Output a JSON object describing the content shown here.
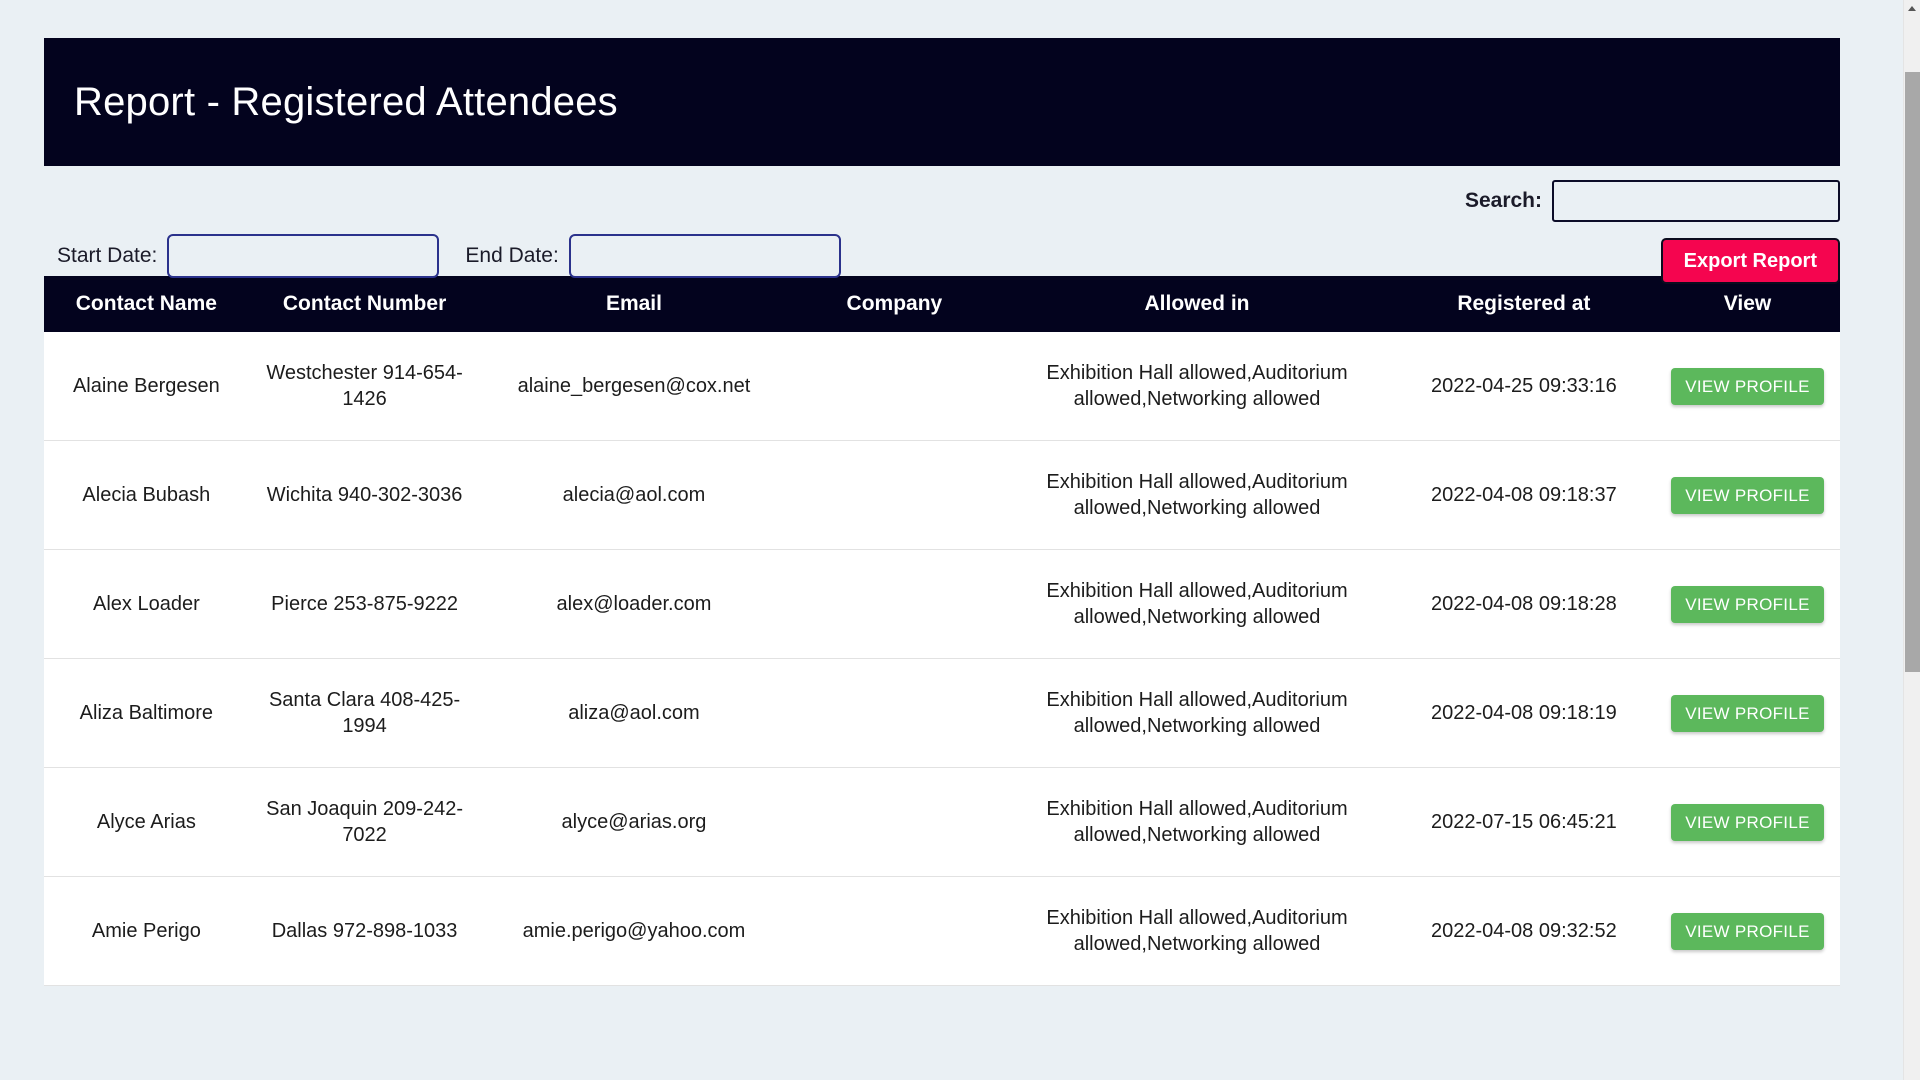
{
  "header": {
    "title": "Report - Registered Attendees",
    "background_color": "#03031e"
  },
  "controls": {
    "search_label": "Search:",
    "search_value": "",
    "search_placeholder": "",
    "start_date_label": "Start Date:",
    "start_date_value": "",
    "start_date_placeholder": "",
    "end_date_label": "End Date:",
    "end_date_value": "",
    "end_date_placeholder": "",
    "export_label": "Export Report",
    "export_color": "#f5054f"
  },
  "table": {
    "columns": [
      "Contact Name",
      "Contact Number",
      "Email",
      "Company",
      "Allowed in",
      "Registered at",
      "View"
    ],
    "view_button_label": "VIEW PROFILE",
    "view_button_color": "#5cb85c",
    "rows": [
      {
        "contact_name": "Alaine Bergesen",
        "contact_number": "Westchester 914-654-1426",
        "email": "alaine_bergesen@cox.net",
        "company": "",
        "allowed_in": "Exhibition Hall allowed,Auditorium allowed,Networking allowed",
        "registered_at": "2022-04-25 09:33:16"
      },
      {
        "contact_name": "Alecia Bubash",
        "contact_number": "Wichita 940-302-3036",
        "email": "alecia@aol.com",
        "company": "",
        "allowed_in": "Exhibition Hall allowed,Auditorium allowed,Networking allowed",
        "registered_at": "2022-04-08 09:18:37"
      },
      {
        "contact_name": "Alex Loader",
        "contact_number": "Pierce 253-875-9222",
        "email": "alex@loader.com",
        "company": "",
        "allowed_in": "Exhibition Hall allowed,Auditorium allowed,Networking allowed",
        "registered_at": "2022-04-08 09:18:28"
      },
      {
        "contact_name": "Aliza Baltimore",
        "contact_number": "Santa Clara 408-425-1994",
        "email": "aliza@aol.com",
        "company": "",
        "allowed_in": "Exhibition Hall allowed,Auditorium allowed,Networking allowed",
        "registered_at": "2022-04-08 09:18:19"
      },
      {
        "contact_name": "Alyce Arias",
        "contact_number": "San Joaquin 209-242-7022",
        "email": "alyce@arias.org",
        "company": "",
        "allowed_in": "Exhibition Hall allowed,Auditorium allowed,Networking allowed",
        "registered_at": "2022-07-15 06:45:21"
      },
      {
        "contact_name": "Amie Perigo",
        "contact_number": "Dallas 972-898-1033",
        "email": "amie.perigo@yahoo.com",
        "company": "",
        "allowed_in": "Exhibition Hall allowed,Auditorium allowed,Networking allowed",
        "registered_at": "2022-04-08 09:32:52"
      }
    ]
  }
}
